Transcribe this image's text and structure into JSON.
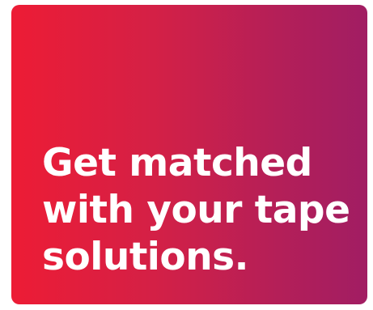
{
  "card": {
    "gradient_start": "#ed1c35",
    "gradient_end": "#a11d63",
    "text_color": "#ffffff"
  },
  "headline": {
    "lines": [
      "Get matched",
      "with your tape",
      "solutions."
    ]
  }
}
